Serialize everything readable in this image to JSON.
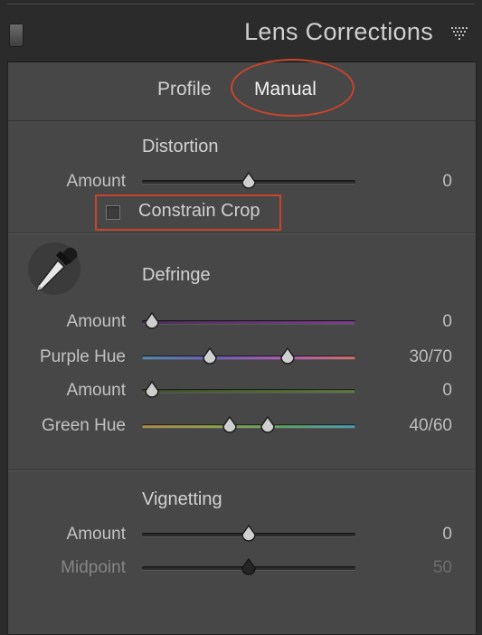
{
  "header": {
    "title": "Lens Corrections"
  },
  "tabs": [
    {
      "label": "Profile"
    },
    {
      "label": "Manual"
    }
  ],
  "distortion": {
    "title": "Distortion",
    "amount": {
      "label": "Amount",
      "value": "0",
      "level": 0.5
    },
    "constrain_crop": {
      "label": "Constrain Crop",
      "checked": false
    }
  },
  "defringe": {
    "title": "Defringe",
    "purple_amount": {
      "label": "Amount",
      "value": "0",
      "level": 0.0
    },
    "purple_hue": {
      "label": "Purple Hue",
      "value": "30/70",
      "low": 0.3,
      "high": 0.7
    },
    "green_amount": {
      "label": "Amount",
      "value": "0",
      "level": 0.0
    },
    "green_hue": {
      "label": "Green Hue",
      "value": "40/60",
      "low": 0.4,
      "high": 0.6
    }
  },
  "vignetting": {
    "title": "Vignetting",
    "amount": {
      "label": "Amount",
      "value": "0",
      "level": 0.5
    },
    "midpoint": {
      "label": "Midpoint",
      "value": "50",
      "level": 0.5
    }
  },
  "colors": {
    "panel_bg": "#474747",
    "outer_bg": "#2b2b2b",
    "highlight": "#c8452c"
  },
  "icons": {
    "collapse": "panel-collapse-icon",
    "menu": "panel-menu-triangle-icon",
    "picker": "eyedropper-icon",
    "thumb": "slider-thumb-icon"
  }
}
